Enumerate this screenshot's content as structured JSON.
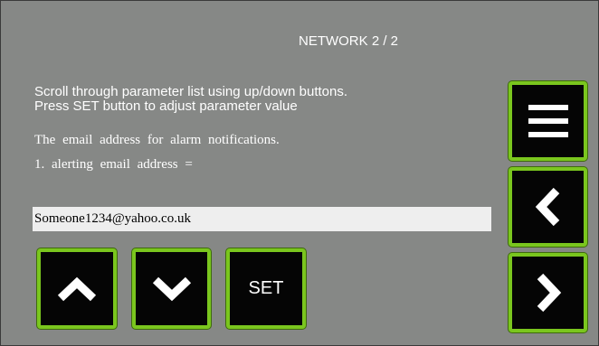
{
  "screen": {
    "title": "NETWORK 2 / 2",
    "help_line1": "Scroll through parameter list using up/down buttons.",
    "help_line2": "Press SET button to adjust parameter value",
    "description": "The email address for alarm notifications.",
    "parameter_label": "1. alerting email address =",
    "parameter_value": "Someone1234@yahoo.co.uk"
  },
  "buttons": {
    "up_icon": "chevron-up-icon",
    "down_icon": "chevron-down-icon",
    "set_label": "SET",
    "menu_icon": "menu-icon",
    "back_icon": "chevron-left-icon",
    "next_icon": "chevron-right-icon"
  },
  "colors": {
    "background": "#868886",
    "button_fill": "#050505",
    "button_border": "#7ac61e",
    "value_field": "#eeeeee"
  }
}
